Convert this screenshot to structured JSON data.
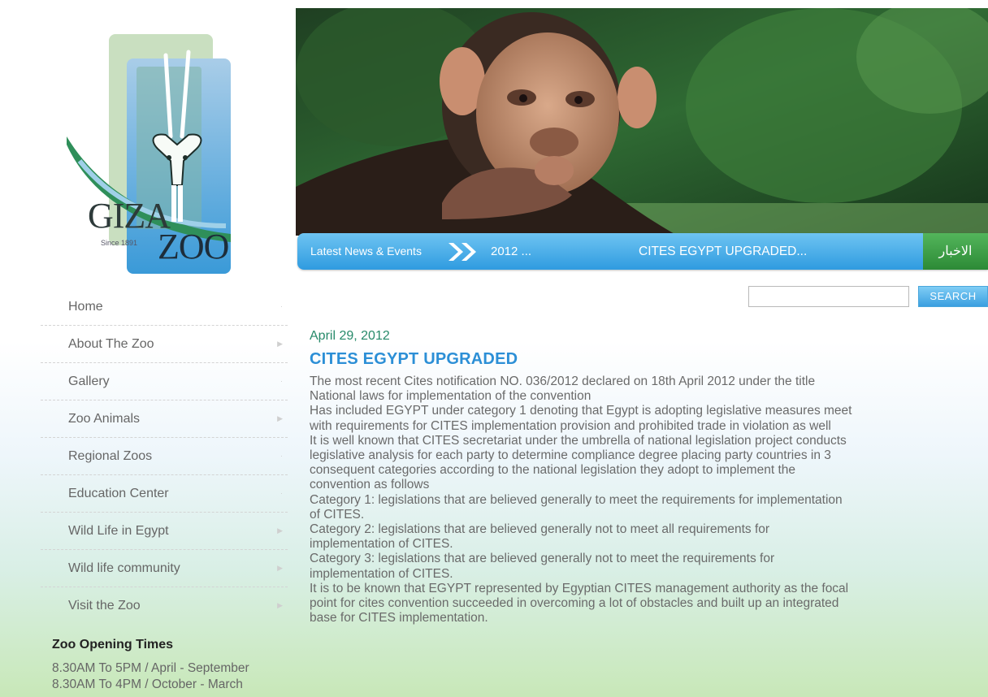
{
  "logo": {
    "name_top": "GIZA",
    "name_bottom": "ZOO",
    "since": "Since 1891"
  },
  "nav": {
    "items": [
      {
        "label": "Home",
        "has_submenu": false
      },
      {
        "label": "About The Zoo",
        "has_submenu": true
      },
      {
        "label": "Gallery",
        "has_submenu": false
      },
      {
        "label": "Zoo Animals",
        "has_submenu": true
      },
      {
        "label": "Regional Zoos",
        "has_submenu": false
      },
      {
        "label": "Education Center",
        "has_submenu": false
      },
      {
        "label": "Wild Life in Egypt",
        "has_submenu": true
      },
      {
        "label": "Wild life community",
        "has_submenu": true
      },
      {
        "label": "Visit the Zoo",
        "has_submenu": true
      }
    ]
  },
  "hours": {
    "title": "Zoo Opening Times",
    "lines": [
      "8.30AM To 5PM / April - September",
      "8.30AM To 4PM / October - March"
    ]
  },
  "ticker": {
    "label": "Latest News & Events",
    "year": "2012 ...",
    "headline": "CITES EGYPT UPGRADED...",
    "arabic_button": "الاخبار"
  },
  "search": {
    "value": "",
    "placeholder": "",
    "button": "SEARCH"
  },
  "article": {
    "date": "April 29, 2012",
    "title": "CITES EGYPT UPGRADED",
    "lines": [
      "The most recent Cites notification NO. 036/2012 declared on 18th April 2012 under the title",
      "National laws for implementation of the convention",
      "Has included EGYPT under category 1 denoting that Egypt is adopting legislative measures meet",
      "with requirements for CITES implementation provision and prohibited trade in violation as well",
      "It is well known that CITES secretariat under the umbrella of national legislation project conducts",
      "legislative analysis for each party to determine compliance degree placing party countries in 3",
      "consequent categories according to the national legislation they adopt to implement the",
      "convention as follows",
      "Category 1: legislations that are believed generally to meet the requirements for implementation",
      "of CITES.",
      "Category 2: legislations that are believed generally not to meet all requirements for",
      "implementation of CITES.",
      "Category 3: legislations that are believed generally not to meet the requirements for",
      "implementation of CITES.",
      "It is to be known that EGYPT represented by Egyptian CITES management authority as the focal",
      "point for cites convention succeeded in overcoming a lot of obstacles and built up an integrated",
      "base for CITES implementation."
    ]
  },
  "colors": {
    "accent_blue": "#2c8fd6",
    "ticker_blue": "#2f9be0",
    "arabic_green": "#2c8a36",
    "date_green": "#278a6a"
  }
}
